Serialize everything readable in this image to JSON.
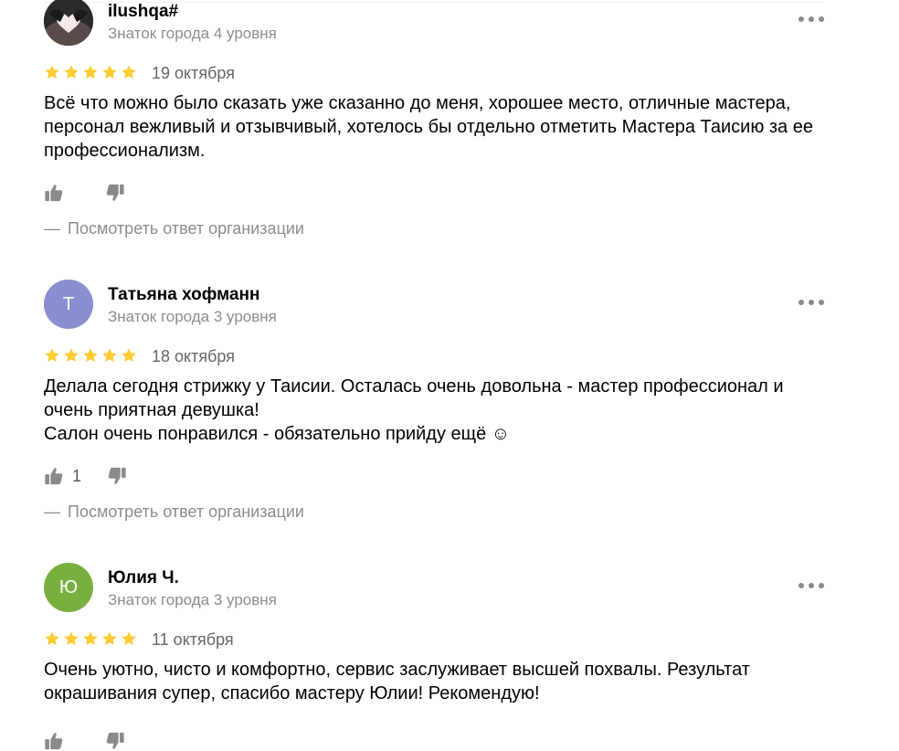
{
  "reviews": [
    {
      "author": "ilushqa#",
      "level": "Знаток города 4 уровня",
      "avatar_type": "photo",
      "avatar_letter": "",
      "avatar_color": "#1c1c1c",
      "rating": 5,
      "date": "19 октября",
      "text_lines": [
        "Всё что можно было сказать уже сказанно до меня, хорошее место, отличные мастера, персонал вежливый и отзывчивый, хотелось бы отдельно отметить Мастера Таисию за ее профессионализм."
      ],
      "likes": "",
      "answer_link": "Посмотреть ответ организации",
      "icons": {
        "like": "thumbs-up-icon",
        "dislike": "thumbs-down-icon",
        "more": "more-dots-icon"
      }
    },
    {
      "author": "Татьяна хофманн",
      "level": "Знаток города 3 уровня",
      "avatar_type": "letter",
      "avatar_letter": "Т",
      "avatar_color": "#8c8ed2",
      "rating": 5,
      "date": "18 октября",
      "text_lines": [
        "Делала сегодня стрижку у Таисии. Осталась очень довольна - мастер профессионал и очень приятная девушка!",
        "Салон очень понравился - обязательно прийду ещё ☺"
      ],
      "likes": "1",
      "answer_link": "Посмотреть ответ организации",
      "icons": {
        "like": "thumbs-up-icon",
        "dislike": "thumbs-down-icon",
        "more": "more-dots-icon"
      }
    },
    {
      "author": "Юлия Ч.",
      "level": "Знаток города 3 уровня",
      "avatar_type": "letter",
      "avatar_letter": "Ю",
      "avatar_color": "#78b040",
      "rating": 5,
      "date": "11 октября",
      "text_lines": [
        "Очень уютно, чисто и комфортно, сервис заслуживает высшей похвалы. Результат окрашивания супер, спасибо мастеру Юлии! Рекомендую!"
      ],
      "likes": "",
      "answer_link": "",
      "icons": {
        "like": "thumbs-up-icon",
        "dislike": "thumbs-down-icon",
        "more": "more-dots-icon"
      }
    }
  ],
  "colors": {
    "star": "#fc3",
    "muted_text": "#8c8c8c",
    "icon_gray": "#8a8a8a"
  }
}
